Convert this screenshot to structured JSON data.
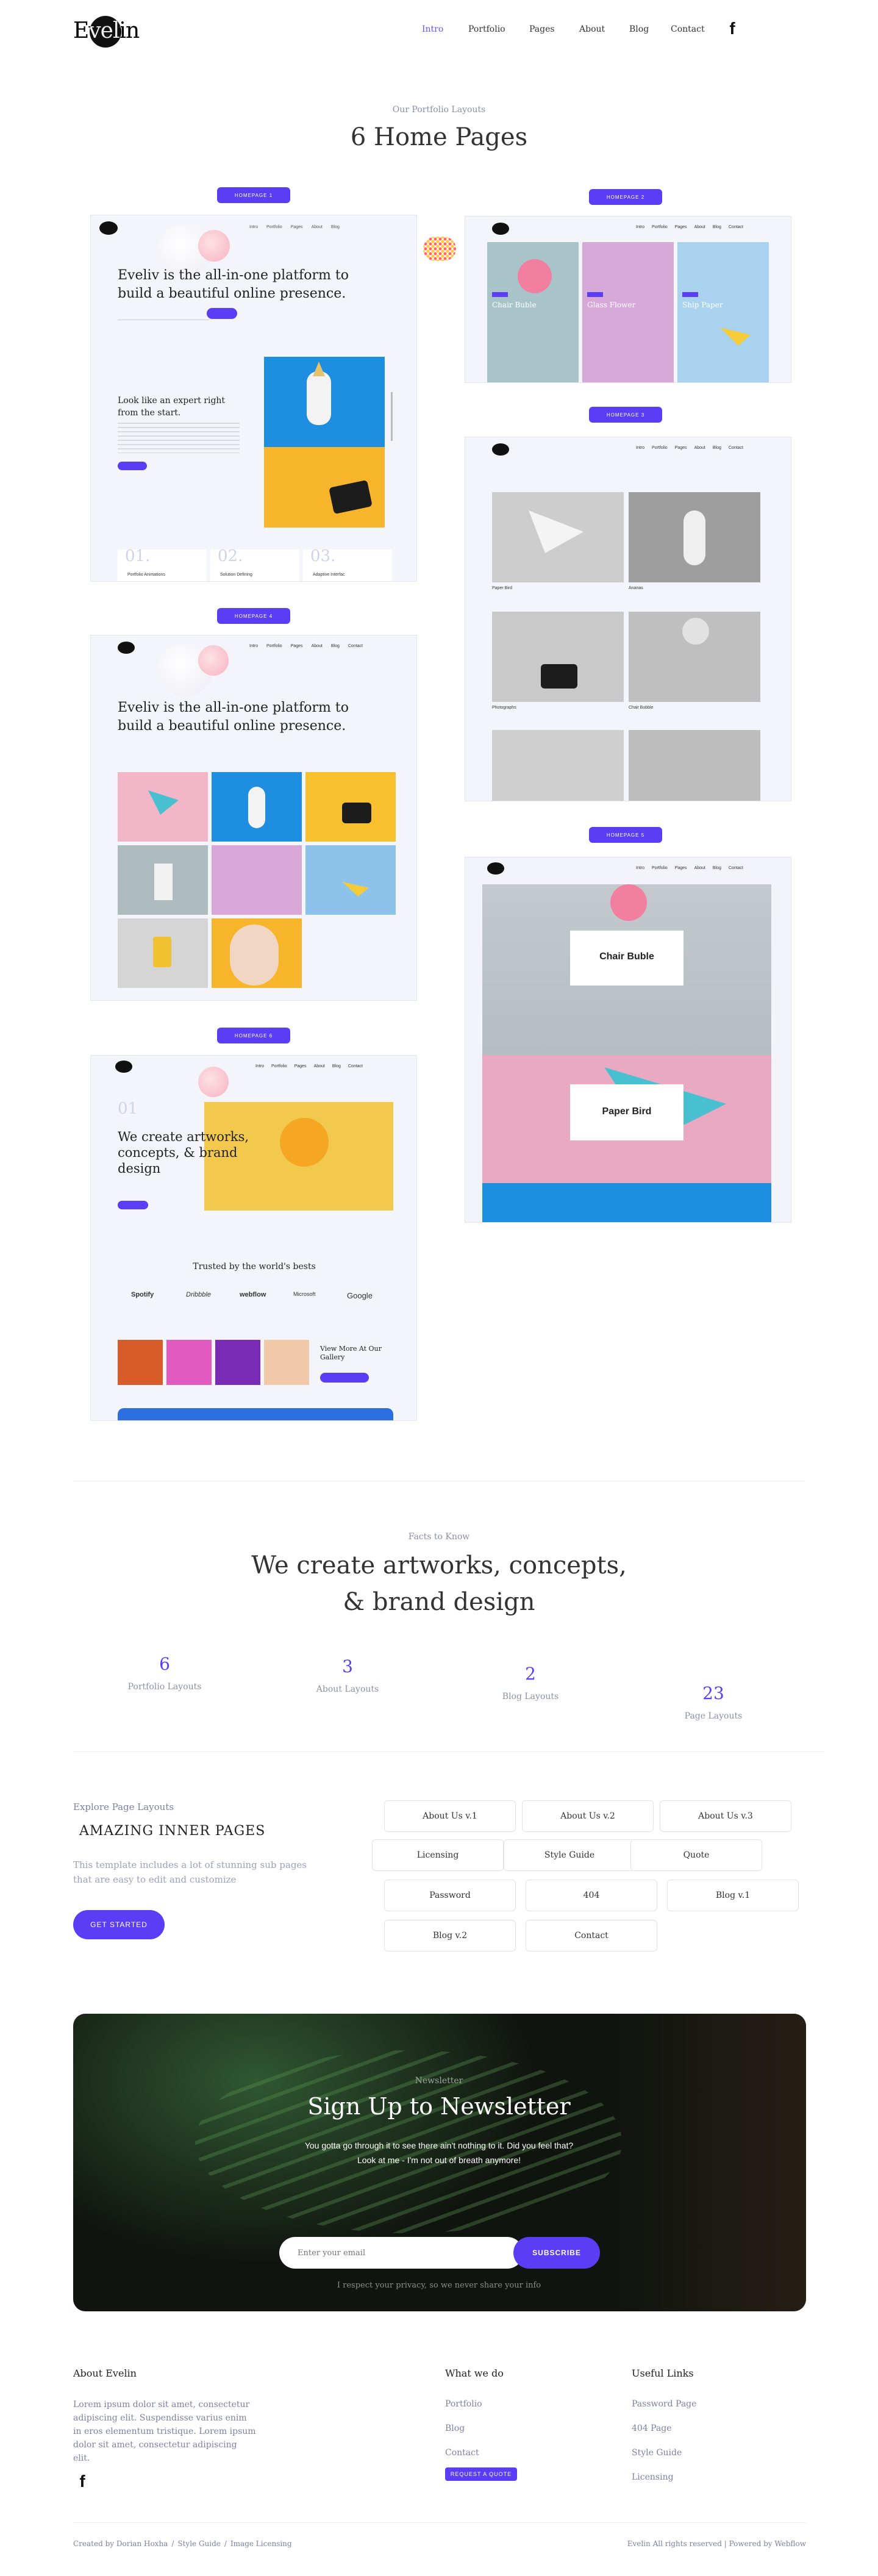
{
  "header": {
    "logo": "Evelin",
    "nav": [
      "Intro",
      "Portfolio",
      "Pages",
      "About",
      "Blog",
      "Contact"
    ],
    "social_icon": "facebook-icon"
  },
  "layouts": {
    "kicker": "Our Portfolio Layouts",
    "title": "6 Home Pages",
    "buttons": [
      "HOMEPAGE 1",
      "HOMEPAGE 2",
      "HOMEPAGE 3",
      "HOMEPAGE 4",
      "HOMEPAGE 5",
      "HOMEPAGE 6"
    ],
    "hp1": {
      "headline": "Eveliv is the all-in-one platform to build a beautiful online presence.",
      "sub": "Look like an expert right from the start.",
      "nums": [
        "01.",
        "02.",
        "03."
      ],
      "num_labels": [
        "Portfolio Animations",
        "Solution Defining",
        "Adaptive Interfac"
      ]
    },
    "hp2": {
      "captions": [
        "Chair Buble",
        "Glass Flower",
        "Ship Paper"
      ]
    },
    "hp3": {
      "captions": [
        "Paper Bird",
        "Ananas",
        "Photographs",
        "Chair Bubble"
      ]
    },
    "hp4": {
      "headline": "Eveliv is the all-in-one platform to build a beautiful online presence."
    },
    "hp5": {
      "number": "01",
      "headline": "We create artworks, concepts, & brand design",
      "trusted": "Trusted by the world's bests",
      "brands": [
        "Spotify",
        "Dribbble",
        "webflow",
        "Microsoft",
        "Google"
      ],
      "gallery_text": "View More At Our Gallery"
    },
    "hp6": {
      "cards": [
        "Chair Buble",
        "Paper Bird"
      ]
    }
  },
  "facts": {
    "kicker": "Facts to Know",
    "title_line1": "We create artworks, concepts,",
    "title_line2": "& brand design",
    "stats": [
      {
        "num": "6",
        "label": "Portfolio Layouts"
      },
      {
        "num": "3",
        "label": "About Layouts"
      },
      {
        "num": "2",
        "label": "Blog Layouts"
      },
      {
        "num": "23",
        "label": "Page Layouts"
      }
    ]
  },
  "inner": {
    "kicker": "Explore Page Layouts",
    "title": "AMAZING INNER PAGES",
    "desc": "This template includes a lot of stunning sub pages that are easy to edit and customize",
    "cta": "GET STARTED",
    "pages": [
      "About Us v.1",
      "About Us v.2",
      "About Us v.3",
      "Licensing",
      "Style Guide",
      "Quote",
      "Password",
      "404",
      "Blog v.1",
      "Blog v.2",
      "Contact"
    ]
  },
  "newsletter": {
    "kicker": "Newsletter",
    "title": "Sign Up to Newsletter",
    "desc_line1": "You gotta go through it to see there ain't nothing to it. Did you feel that?",
    "desc_line2": "Look at me - I'm not out of breath anymore!",
    "placeholder": "Enter your email",
    "button": "SUBSCRIBE",
    "privacy": "I respect your privacy, so we never share your info"
  },
  "footer": {
    "about_title": "About Evelin",
    "about_text": "Lorem ipsum dolor sit amet, consectetur adipiscing elit. Suspendisse varius enim in eros elementum tristique. Lorem ipsum dolor sit amet, consectetur adipiscing elit.",
    "whatwedo_title": "What we do",
    "whatwedo": [
      "Portfolio",
      "Blog",
      "Contact"
    ],
    "quote_button": "REQUEST A QUOTE",
    "useful_title": "Useful Links",
    "useful": [
      "Password Page",
      "404 Page",
      "Style Guide",
      "Licensing"
    ],
    "bottom_left": [
      "Created by Dorian Hoxha",
      "Style Guide",
      "Image Licensing"
    ],
    "bottom_right": "Evelin All rights reserved | Powered by Webflow"
  },
  "colors": {
    "accent": "#5b3df5",
    "muted": "#8c8fa8"
  }
}
